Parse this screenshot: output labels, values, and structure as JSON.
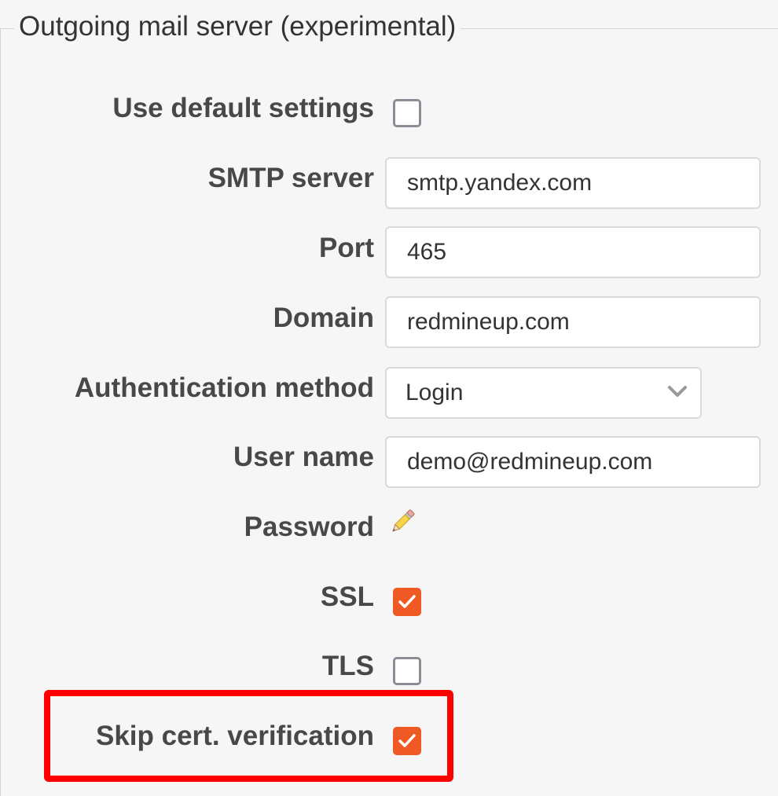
{
  "legend": "Outgoing mail server (experimental)",
  "fields": {
    "use_default": {
      "label": "Use default settings",
      "checked": false
    },
    "smtp_server": {
      "label": "SMTP server",
      "value": "smtp.yandex.com"
    },
    "port": {
      "label": "Port",
      "value": "465"
    },
    "domain": {
      "label": "Domain",
      "value": "redmineup.com"
    },
    "auth_method": {
      "label": "Authentication method",
      "value": "Login"
    },
    "user_name": {
      "label": "User name",
      "value": "demo@redmineup.com"
    },
    "password": {
      "label": "Password",
      "icon": "pencil-icon"
    },
    "ssl": {
      "label": "SSL",
      "checked": true
    },
    "tls": {
      "label": "TLS",
      "checked": false
    },
    "skip_cert": {
      "label": "Skip cert. verification",
      "checked": true
    }
  },
  "colors": {
    "accent": "#ef5a24",
    "highlight": "#ff0000",
    "label_text": "#484848",
    "background": "#f6f6f6"
  }
}
